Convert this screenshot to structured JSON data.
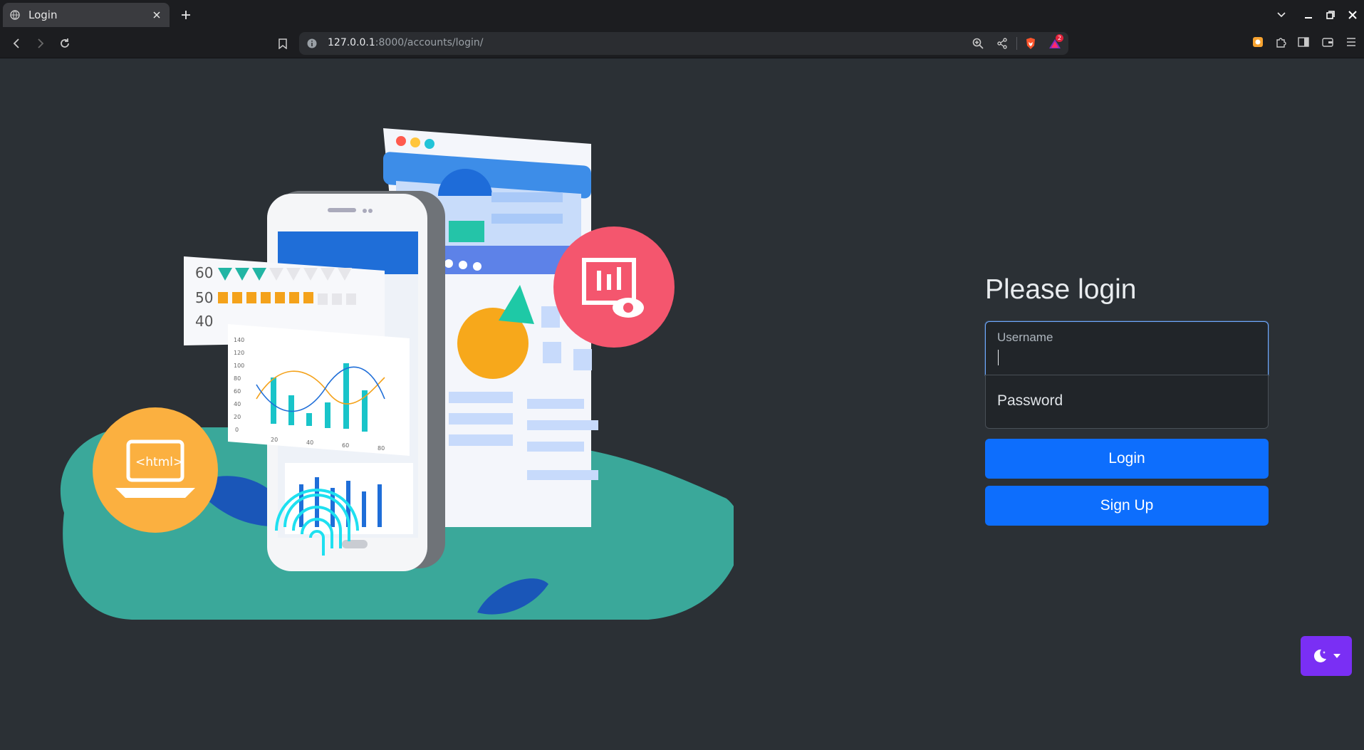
{
  "browser": {
    "tab_title": "Login",
    "url_host": "127.0.0.1",
    "url_rest": ":8000/accounts/login/",
    "notification_count": "2"
  },
  "login": {
    "heading": "Please login",
    "username_label": "Username",
    "password_label": "Password",
    "login_button": "Login",
    "signup_button": "Sign Up"
  },
  "illustration": {
    "bar_labels": [
      "60",
      "50",
      "40"
    ],
    "y_ticks": [
      "140",
      "120",
      "100",
      "80",
      "60",
      "40",
      "20",
      "0"
    ],
    "x_ticks": [
      "20",
      "40",
      "60",
      "80"
    ],
    "html_badge": "<html>"
  },
  "colors": {
    "page_bg": "#2b3035",
    "primary": "#0d6efd",
    "theme_toggle": "#7a2ff4",
    "teal_blob": "#3aa89a"
  }
}
